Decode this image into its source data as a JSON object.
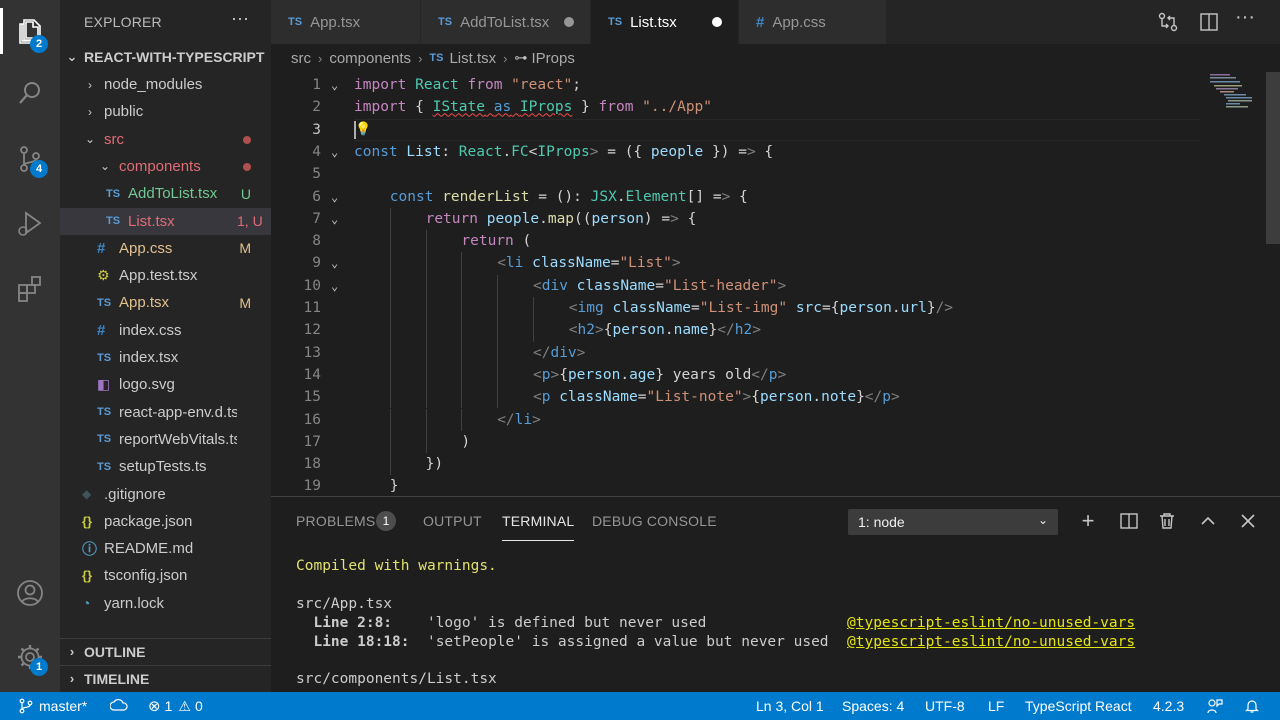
{
  "activity_bar": {
    "explorer_badge": "2",
    "scm_badge": "4",
    "settings_badge": "1"
  },
  "sidebar": {
    "title": "EXPLORER",
    "more": "···",
    "project": "REACT-WITH-TYPESCRIPT",
    "outline": "OUTLINE",
    "timeline": "TIMELINE",
    "items": [
      {
        "label": "node_modules",
        "icon": "chevron-right",
        "decor": ""
      },
      {
        "label": "public",
        "icon": "chevron-right",
        "decor": ""
      },
      {
        "label": "src",
        "icon": "chevron-down",
        "decor": "dot"
      },
      {
        "label": "components",
        "icon": "chevron-down",
        "decor": "dot"
      },
      {
        "label": "AddToList.tsx",
        "icon": "TS",
        "decor": "U"
      },
      {
        "label": "List.tsx",
        "icon": "TS",
        "decor": "1, U"
      },
      {
        "label": "App.css",
        "icon": "#",
        "decor": "M"
      },
      {
        "label": "App.test.tsx",
        "icon": "test-icon",
        "decor": ""
      },
      {
        "label": "App.tsx",
        "icon": "TS",
        "decor": "M"
      },
      {
        "label": "index.css",
        "icon": "#",
        "decor": ""
      },
      {
        "label": "index.tsx",
        "icon": "TS",
        "decor": ""
      },
      {
        "label": "logo.svg",
        "icon": "svg-icon",
        "decor": ""
      },
      {
        "label": "react-app-env.d.ts",
        "icon": "TS",
        "decor": ""
      },
      {
        "label": "reportWebVitals.ts",
        "icon": "TS",
        "decor": ""
      },
      {
        "label": "setupTests.ts",
        "icon": "TS",
        "decor": ""
      },
      {
        "label": ".gitignore",
        "icon": "git-icon",
        "decor": ""
      },
      {
        "label": "package.json",
        "icon": "{}",
        "decor": ""
      },
      {
        "label": "README.md",
        "icon": "info-icon",
        "decor": ""
      },
      {
        "label": "tsconfig.json",
        "icon": "{}",
        "decor": ""
      },
      {
        "label": "yarn.lock",
        "icon": "yarn-icon",
        "decor": ""
      }
    ]
  },
  "tabs": [
    {
      "label": "App.tsx",
      "icon": "TS"
    },
    {
      "label": "AddToList.tsx",
      "icon": "TS"
    },
    {
      "label": "List.tsx",
      "icon": "TS"
    },
    {
      "label": "App.css",
      "icon": "#"
    }
  ],
  "breadcrumb": {
    "part1": "src",
    "part2": "components",
    "part3": "List.tsx",
    "part4": "IProps"
  },
  "editor": {
    "line_numbers": [
      "1",
      "2",
      "3",
      "4",
      "5",
      "6",
      "7",
      "8",
      "9",
      "10",
      "11",
      "12",
      "13",
      "14",
      "15",
      "16",
      "17",
      "18",
      "19"
    ],
    "code": {
      "l1": "import React from \"react\";",
      "l2": "import { IState as IProps } from \"../App\"",
      "l4": "const List: React.FC<IProps> = ({ people }) => {",
      "l6": "const renderList = (): JSX.Element[] => {",
      "l7": "return people.map((person) => {",
      "l8": "return (",
      "l9": "<li className=\"List\">",
      "l10": "<div className=\"List-header\">",
      "l11": "<img className=\"List-img\" src={person.url}/>",
      "l12": "<h2>{person.name}</h2>",
      "l13": "</div>",
      "l14": "<p>{person.age} years old</p>",
      "l15": "<p className=\"List-note\">{person.note}</p>",
      "l16": "</li>",
      "l17": ")",
      "l18": "})",
      "l19": "}"
    }
  },
  "panel": {
    "tabs": [
      "PROBLEMS",
      "OUTPUT",
      "TERMINAL",
      "DEBUG CONSOLE"
    ],
    "problems_count": "1",
    "terminal_select": "1: node",
    "terminal": {
      "line1": "Compiled with warnings.",
      "line2": "src/App.tsx",
      "line3_loc": "  Line 2:8:",
      "line3_msg": "    'logo' is defined but never used",
      "line3_rule": "@typescript-eslint/no-unused-vars",
      "line4_loc": "  Line 18:18:",
      "line4_msg": "  'setPeople' is assigned a value but never used",
      "line4_rule": "@typescript-eslint/no-unused-vars",
      "line5": "src/components/List.tsx"
    }
  },
  "status": {
    "branch": "master*",
    "errors": "1",
    "warnings": "0",
    "position": "Ln 3, Col 1",
    "spaces": "Spaces: 4",
    "encoding": "UTF-8",
    "eol": "LF",
    "language": "TypeScript React",
    "version": "4.2.3"
  },
  "colors": {
    "accent": "#007acc",
    "ts_icon": "#5a9bd5",
    "css_icon": "#3f86c7",
    "modified": "#e2c08d",
    "untracked": "#73c991",
    "error": "#e06c75",
    "folder_red": "#e06c75"
  }
}
